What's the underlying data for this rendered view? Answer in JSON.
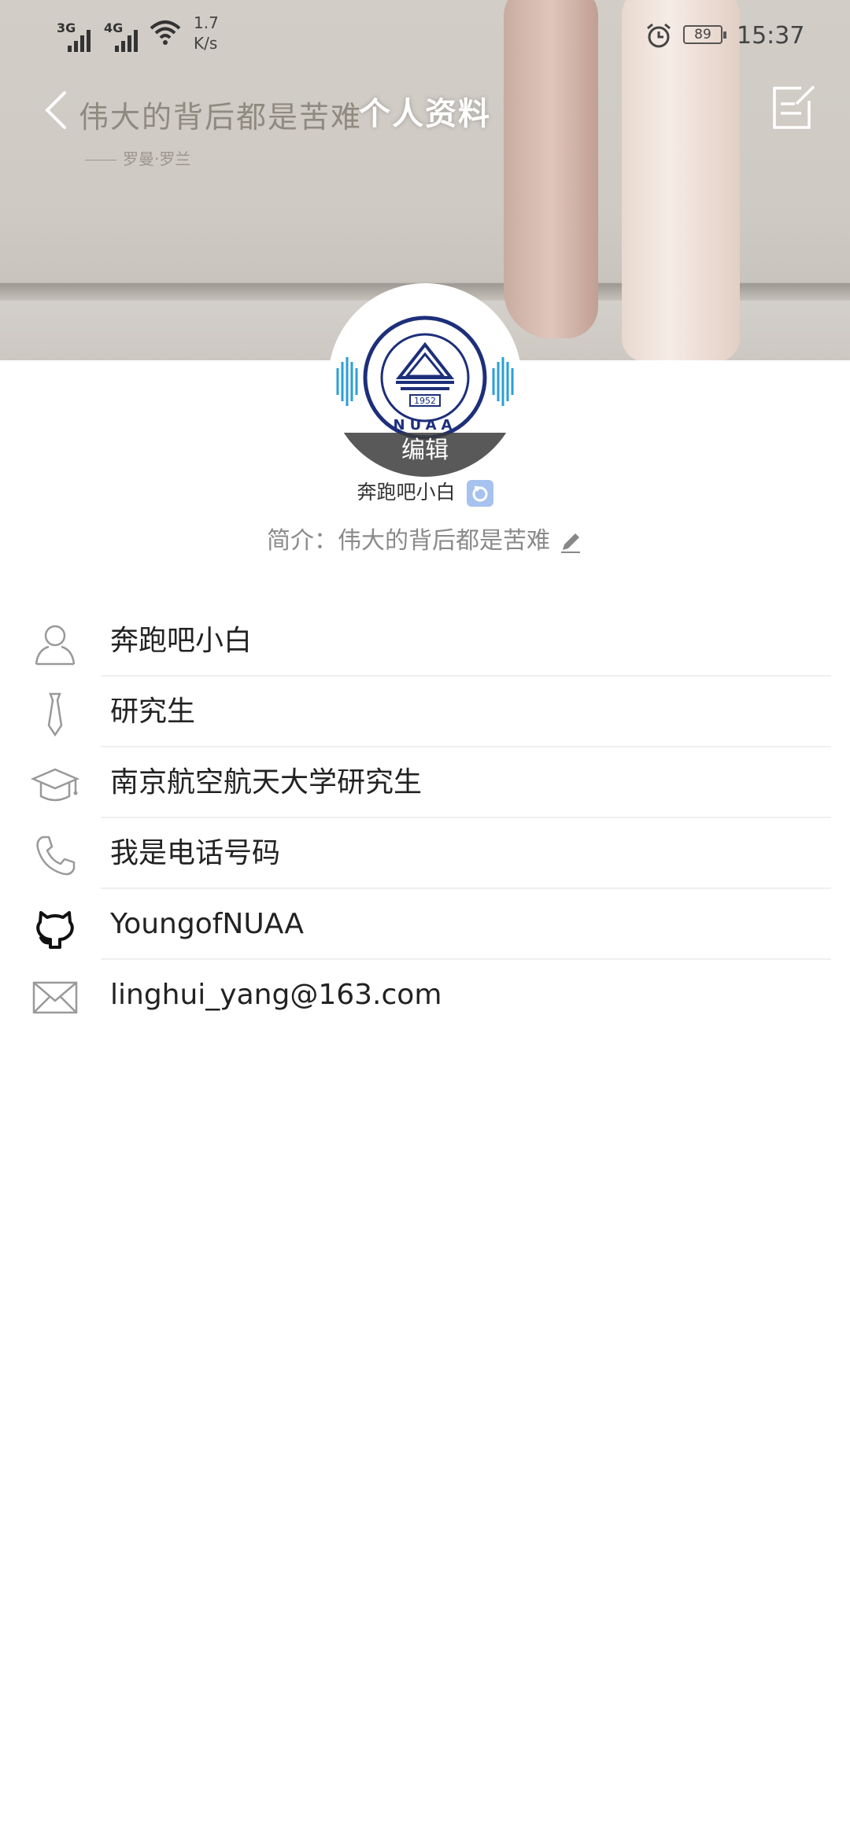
{
  "status_bar": {
    "network_1": "3G",
    "network_2": "4G",
    "speed_value": "1.7",
    "speed_unit": "K/s",
    "battery": "89",
    "time": "15:37"
  },
  "header": {
    "title": "个人资料",
    "banner_quote": "伟大的背后都是苦难",
    "banner_signature": "罗曼·罗兰"
  },
  "profile": {
    "avatar_edit_label": "编辑",
    "nickname": "奔跑吧小白",
    "bio": "简介：伟大的背后都是苦难",
    "avatar_seal_year": "1952",
    "avatar_seal_letters": "NUAA"
  },
  "info_items": [
    {
      "icon": "person-icon",
      "text": "奔跑吧小白"
    },
    {
      "icon": "tie-icon",
      "text": "研究生"
    },
    {
      "icon": "graduation-cap-icon",
      "text": "南京航空航天大学研究生"
    },
    {
      "icon": "phone-icon",
      "text": "我是电话号码"
    },
    {
      "icon": "github-icon",
      "text": "YoungofNUAA"
    },
    {
      "icon": "mail-icon",
      "text": "linghui_yang@163.com"
    }
  ],
  "colors": {
    "accent_blue": "#2a9fd6",
    "badge_blue": "#a7c2ef",
    "seal_navy": "#1d2f7a"
  }
}
